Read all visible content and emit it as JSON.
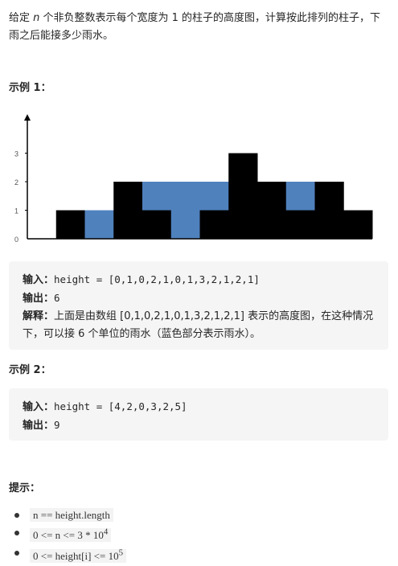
{
  "description": {
    "before": "给定 ",
    "var": "n",
    "after": " 个非负整数表示每个宽度为 1 的柱子的高度图，计算按此排列的柱子，下雨之后能接多少雨水。"
  },
  "example1": {
    "title": "示例 1：",
    "input_label": "输入：",
    "input": "height = [0,1,0,2,1,0,1,3,2,1,2,1]",
    "output_label": "输出：",
    "output": "6",
    "explain_label": "解释：",
    "explain": "上面是由数组 [0,1,0,2,1,0,1,3,2,1,2,1] 表示的高度图，在这种情况下，可以接 6 个单位的雨水（蓝色部分表示雨水）。"
  },
  "example2": {
    "title": "示例 2：",
    "input_label": "输入：",
    "input": "height = [4,2,0,3,2,5]",
    "output_label": "输出：",
    "output": "9"
  },
  "hints": {
    "title": "提示：",
    "items": [
      {
        "text": "n == height.length",
        "sup": ""
      },
      {
        "text": "0 <= n <= 3 * 10",
        "sup": "4"
      },
      {
        "text": "0 <= height[i] <= 10",
        "sup": "5"
      }
    ]
  },
  "chart_data": {
    "type": "bar",
    "heights": [
      0,
      1,
      0,
      2,
      1,
      0,
      1,
      3,
      2,
      1,
      2,
      1
    ],
    "water": [
      0,
      0,
      1,
      0,
      1,
      2,
      1,
      0,
      0,
      1,
      0,
      0
    ],
    "yticks": [
      "0",
      "1",
      "2",
      "3"
    ],
    "ylim": [
      0,
      4
    ],
    "colors": {
      "bar": "#000000",
      "water": "#4f81bd"
    }
  }
}
